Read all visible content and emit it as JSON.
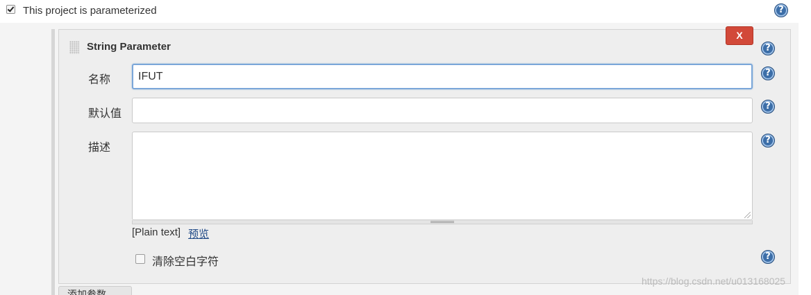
{
  "parameterized": {
    "checked": true,
    "label": "This project is parameterized"
  },
  "parameter": {
    "title": "String Parameter",
    "delete_label": "X",
    "name_label": "名称",
    "name_value": "IFUT",
    "default_label": "默认值",
    "default_value": "",
    "description_label": "描述",
    "description_value": "",
    "format_text": "[Plain text]",
    "preview_link": "预览",
    "trim_checked": false,
    "trim_label": "清除空白字符"
  },
  "help_icon_glyph": "?",
  "add_button_label": "添加参数",
  "watermark": "https://blog.csdn.net/u013168025",
  "colors": {
    "delete_button": "#d24939",
    "help_icon": "#3c6ea8",
    "focus_border": "#7aa6d9",
    "link": "#204a87"
  },
  "icons": [
    "checkbox-checked",
    "help-icon",
    "drag-handle-icon",
    "close-icon",
    "resize-handle-icon",
    "checkbox-unchecked"
  ]
}
